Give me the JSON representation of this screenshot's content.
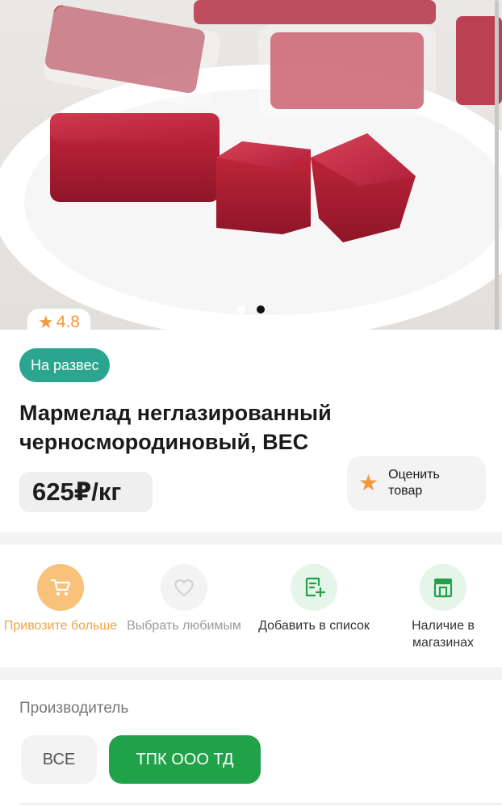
{
  "product": {
    "image_alt": "черносмородиновый мармелад",
    "gallery": {
      "count": 2,
      "active_index": 1
    },
    "rating": "4.8",
    "badge": "На развес",
    "title": "Мармелад неглазированный черносмородиновый, ВЕС",
    "price": "625₽/кг",
    "rate_button": "Оценить товар"
  },
  "actions": [
    {
      "label": "Привозите больше",
      "icon": "cart-icon",
      "color": "#f6ad4d",
      "circle_bg": "#f8c27b",
      "text_color": "#f0a442"
    },
    {
      "label": "Выбрать любимым",
      "icon": "heart-icon",
      "color": "#cfcfcf",
      "circle_bg": "#f3f3f3",
      "text_color": "#9a9a9a"
    },
    {
      "label": "Добавить в список",
      "icon": "add-to-list-icon",
      "color": "#21a24a",
      "circle_bg": "#e5f5e9",
      "text_color": "#333333"
    },
    {
      "label": "Наличие в магазинах",
      "icon": "store-icon",
      "color": "#21a24a",
      "circle_bg": "#e5f5e9",
      "text_color": "#333333"
    }
  ],
  "manufacturer": {
    "title": "Производитель",
    "chips": [
      "ВСЕ",
      "ТПК ООО ТД"
    ],
    "selected": "ТПК ООО ТД"
  },
  "colors": {
    "badge": "#2ba58f",
    "accent_green": "#21a24a",
    "star": "#f29a3b"
  }
}
